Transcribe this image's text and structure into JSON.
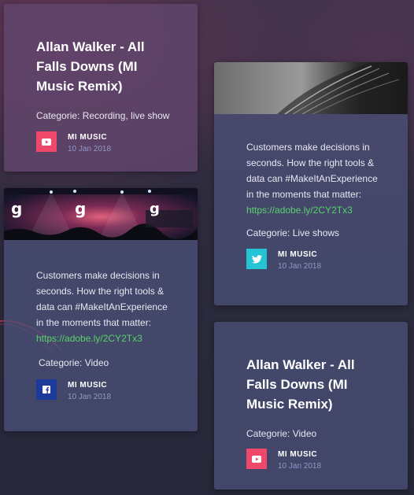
{
  "cards": [
    {
      "title": "Allan Walker - All Falls Downs (MI Music Remix)",
      "category": "Categorie: Recording, live show",
      "author": "MI MUSIC",
      "date": "10 Jan 2018",
      "icon": "youtube-icon",
      "icon_color": "#f0486a"
    },
    {
      "desc_text": "Customers make decisions in seconds. How the right tools & data can #MakeItAnExperience in the moments that matter:",
      "link": "https://adobe.ly/2CY2Tx3",
      "category": "Categorie: Live shows",
      "author": "MI MUSIC",
      "date": "10 Jan 2018",
      "icon": "twitter-icon",
      "icon_color": "#24c4d4"
    },
    {
      "desc_text": "Customers make decisions in seconds. How the right tools & data can #MakeItAnExperience in the moments that matter:",
      "link": "https://adobe.ly/2CY2Tx3",
      "category": "Categorie: Video",
      "author": "MI MUSIC",
      "date": "10 Jan 2018",
      "icon": "facebook-icon",
      "icon_color": "#1b3a9a"
    },
    {
      "title": "Allan Walker - All Falls Downs (MI Music Remix)",
      "category": "Categorie: Video",
      "author": "MI MUSIC",
      "date": "10 Jan 2018",
      "icon": "youtube-icon",
      "icon_color": "#f0486a"
    }
  ],
  "concert_letter": "g",
  "colors": {
    "link": "#57d36b",
    "date": "#8f98c8"
  }
}
